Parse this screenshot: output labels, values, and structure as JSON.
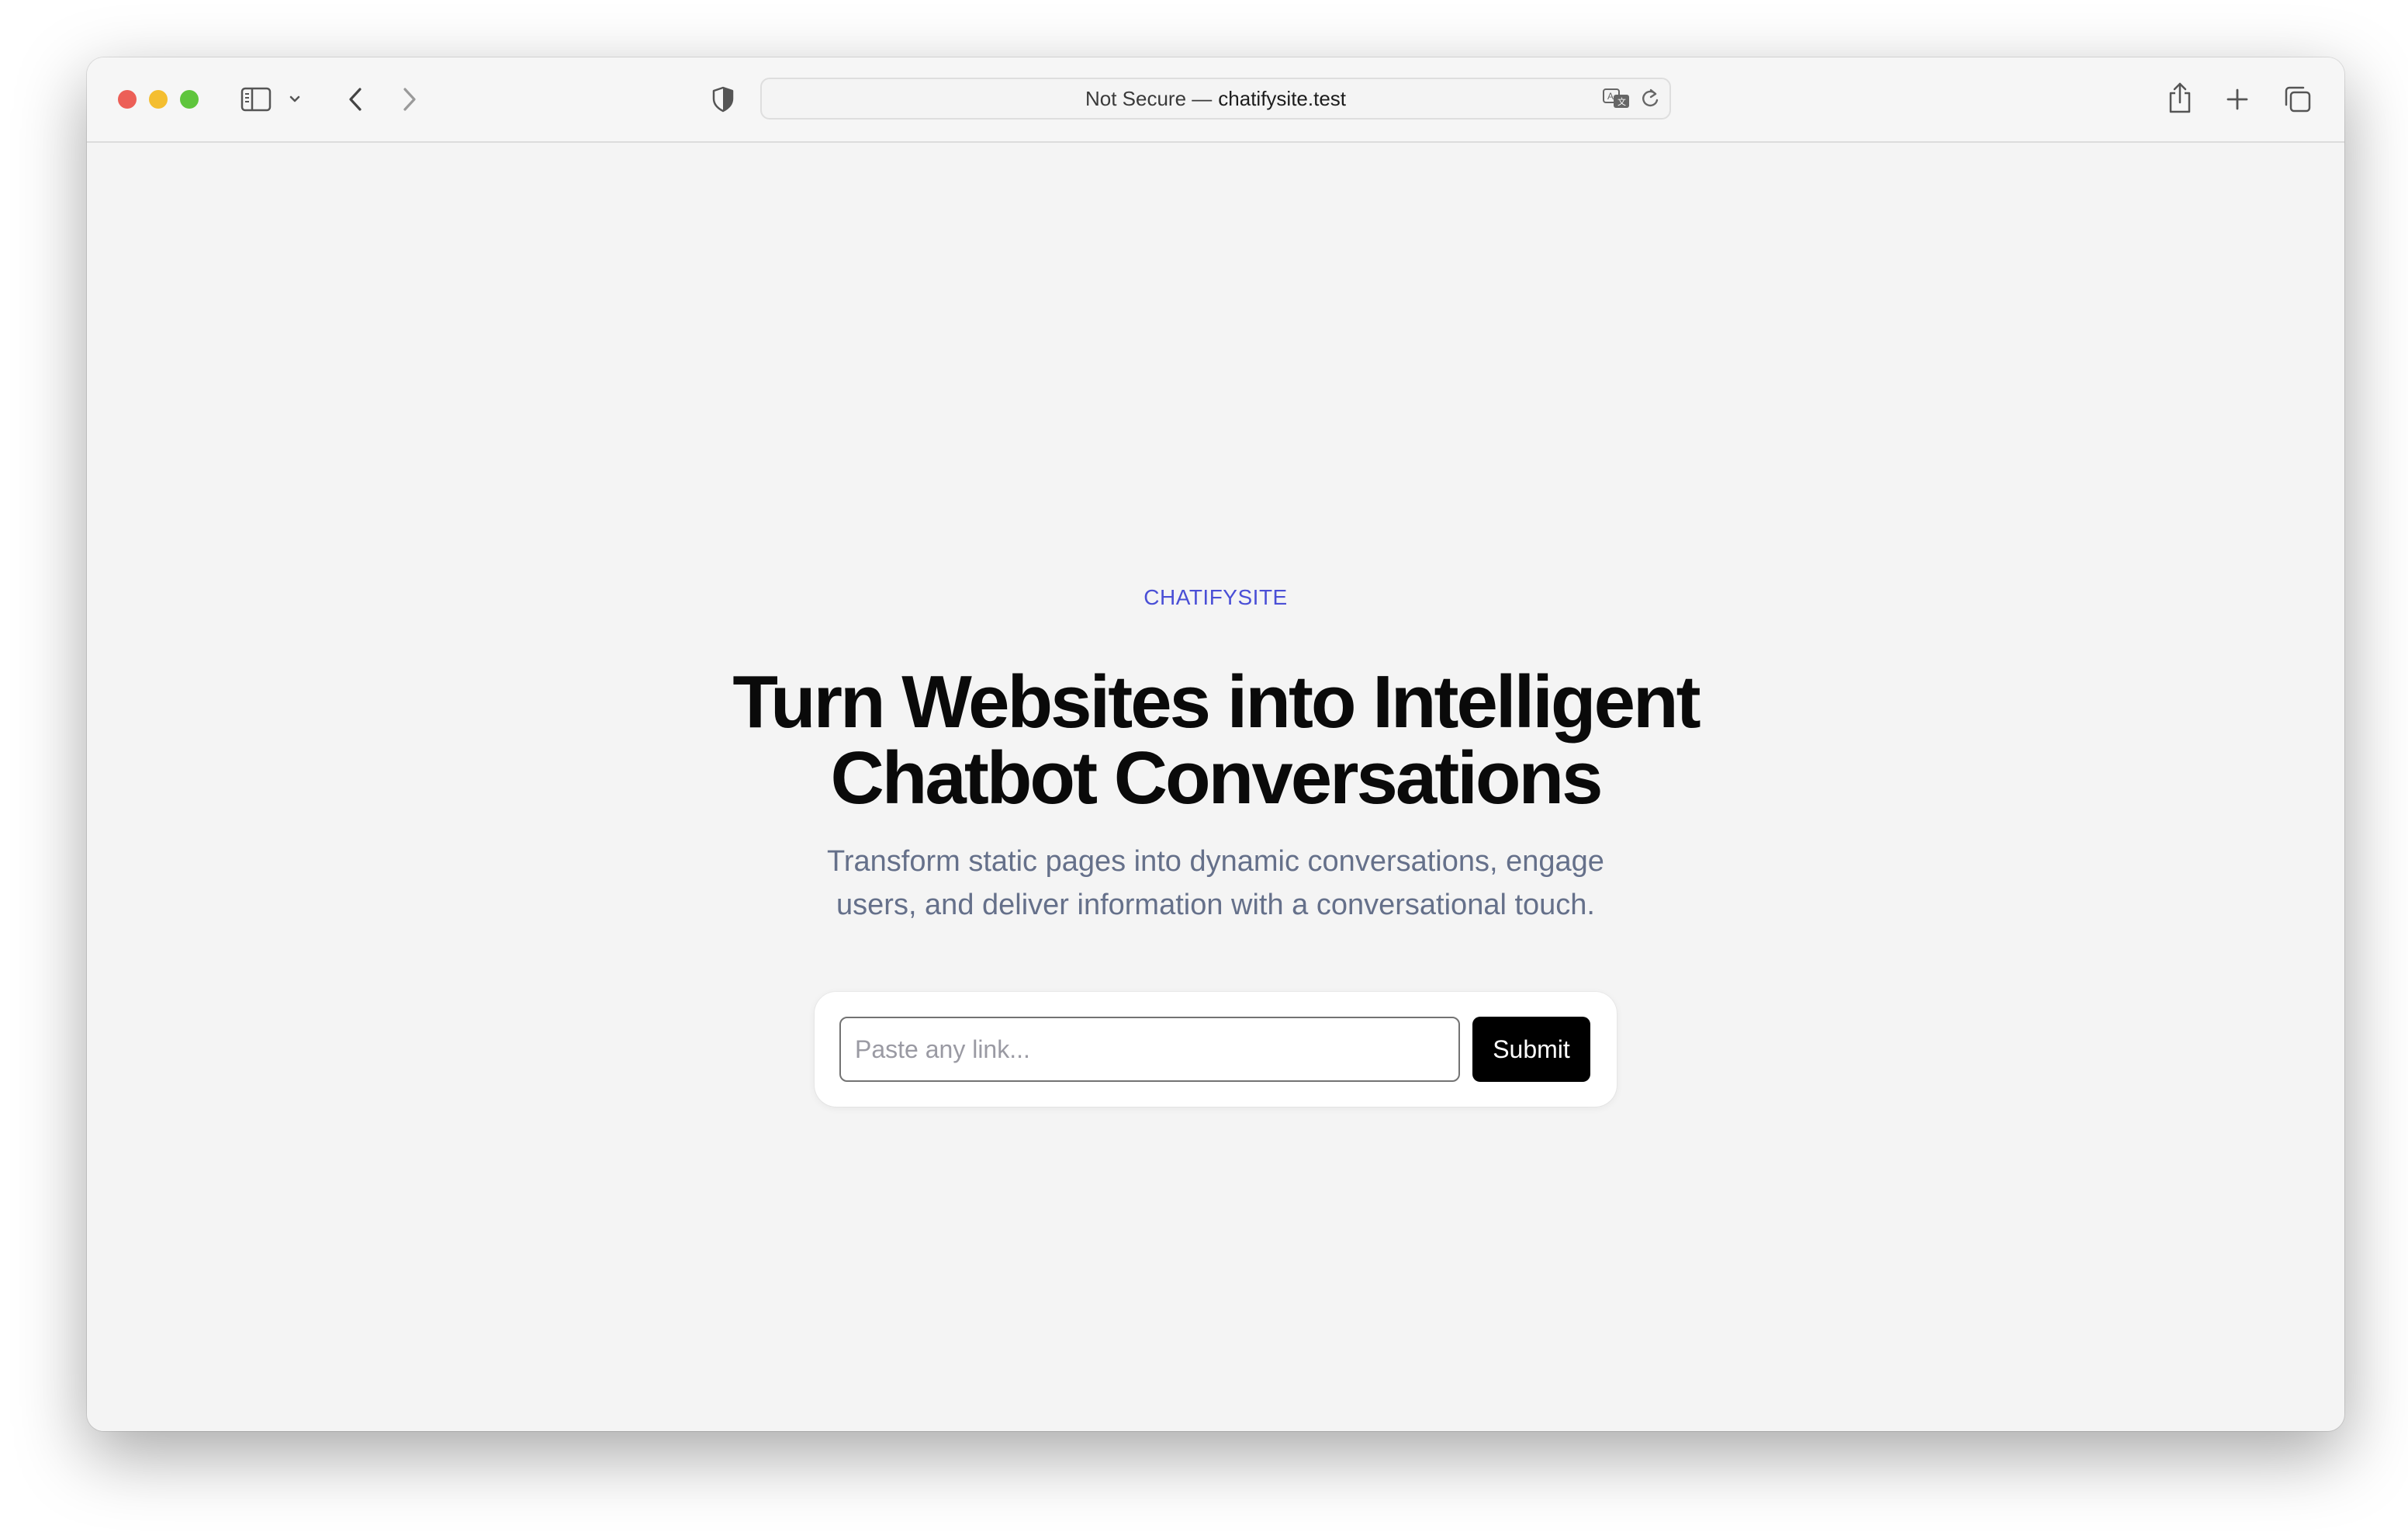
{
  "browser": {
    "address_prefix": "Not Secure —",
    "address_domain": "chatifysite.test",
    "icons": {
      "sidebar": "sidebar-icon",
      "sidebar_menu": "chevron-down-icon",
      "back": "chevron-left-icon",
      "forward": "chevron-right-icon",
      "privacy": "shield-icon",
      "translate": "translate-icon",
      "reload": "reload-icon",
      "share": "share-icon",
      "new_tab": "plus-icon",
      "tabs": "tabs-overview-icon"
    },
    "traffic_light_colors": {
      "close": "#ec5f57",
      "minimize": "#f4be30",
      "zoom": "#5fc53d"
    }
  },
  "page": {
    "brand": "CHATIFYSITE",
    "headline_line1": "Turn Websites into Intelligent",
    "headline_line2": "Chatbot Conversations",
    "subtext_line1": "Transform static pages into dynamic conversations, engage",
    "subtext_line2": "users, and deliver information with a conversational touch.",
    "input_placeholder": "Paste any link...",
    "input_value": "",
    "submit_label": "Submit",
    "accent_color": "#4a4fd6"
  }
}
